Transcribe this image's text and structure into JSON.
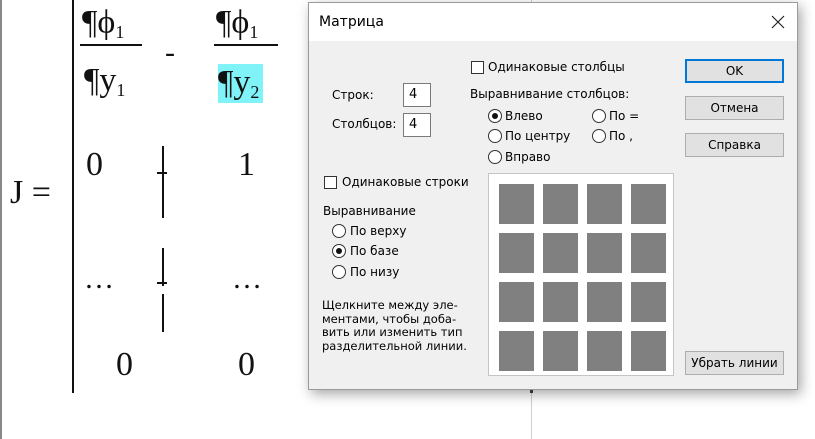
{
  "editor": {
    "lhs": "J",
    "eq": "=",
    "partial": "¶",
    "phi": "ϕ",
    "y": "y",
    "sub1": "1",
    "sub2": "2",
    "minus": "-",
    "zero": "0",
    "one": "1",
    "ellipsis": "…",
    "highlight_color": "#7ff3f8"
  },
  "dialog": {
    "title": "Матрица",
    "close_icon": "close-icon",
    "rows_label": "Строк:",
    "rows_value": "4",
    "cols_label": "Столбцов:",
    "cols_value": "4",
    "same_cols_label": "Одинаковые столбцы",
    "same_cols_checked": false,
    "col_align_label": "Выравнивание столбцов:",
    "col_align": {
      "left": "Влево",
      "center": "По центру",
      "right": "Вправо",
      "equal": "По =",
      "comma": "По ,",
      "selected": "left"
    },
    "same_rows_label": "Одинаковые строки",
    "same_rows_checked": false,
    "row_align_label": "Выравнивание",
    "row_align": {
      "top": "По верху",
      "base": "По базе",
      "bottom": "По низу",
      "selected": "base"
    },
    "hint": "Щелкните между эле-\nментами, чтобы доба-\nвить или изменить тип\nразделительной линии.",
    "buttons": {
      "ok": "OK",
      "cancel": "Отмена",
      "help": "Справка",
      "remove_lines": "Убрать линии"
    },
    "grid": {
      "rows": 4,
      "cols": 4,
      "cell_color": "#808080"
    },
    "accent_color": "#0078d7"
  }
}
